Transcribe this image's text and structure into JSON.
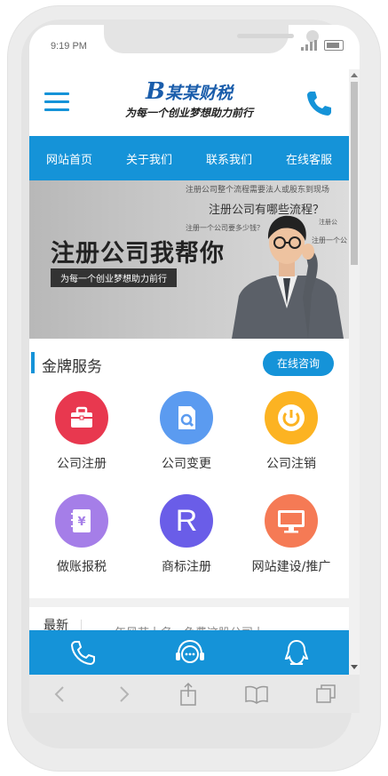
{
  "status_bar": {
    "time": "9:19 PM"
  },
  "header": {
    "logo_mark": "B",
    "logo_name": "某某财税",
    "slogan": "为每一个创业梦想助力前行"
  },
  "nav": {
    "items": [
      {
        "label": "网站首页"
      },
      {
        "label": "关于我们"
      },
      {
        "label": "联系我们"
      },
      {
        "label": "在线客服"
      }
    ]
  },
  "banner": {
    "top_caption": "注册公司整个流程需要法人或股东到现场",
    "question": "注册公司有哪些流程？",
    "cost_caption": "注册一个公司要多少钱？",
    "tiny1": "注册公",
    "tiny2": "注册一个公",
    "headline": "注册公司我帮你",
    "subline": "为每一个创业梦想助力前行"
  },
  "services_section": {
    "title": "金牌服务",
    "consult_button": "在线咨询",
    "items": [
      {
        "label": "公司注册",
        "color": "#e8384f",
        "icon": "briefcase-icon"
      },
      {
        "label": "公司变更",
        "color": "#5b9bf0",
        "icon": "document-search-icon"
      },
      {
        "label": "公司注销",
        "color": "#fcb322",
        "icon": "power-icon"
      },
      {
        "label": "做账报税",
        "color": "#a57ee8",
        "icon": "ledger-icon"
      },
      {
        "label": "商标注册",
        "color": "#6a5de8",
        "glyph": "R",
        "icon": "trademark-icon"
      },
      {
        "label": "网站建设/推广",
        "color": "#f57a55",
        "icon": "monitor-icon"
      }
    ]
  },
  "news": {
    "label": "最新",
    "headline": "年风节上名…色费这股公司上"
  },
  "colors": {
    "primary": "#1593d8",
    "brand": "#1a5dab"
  }
}
